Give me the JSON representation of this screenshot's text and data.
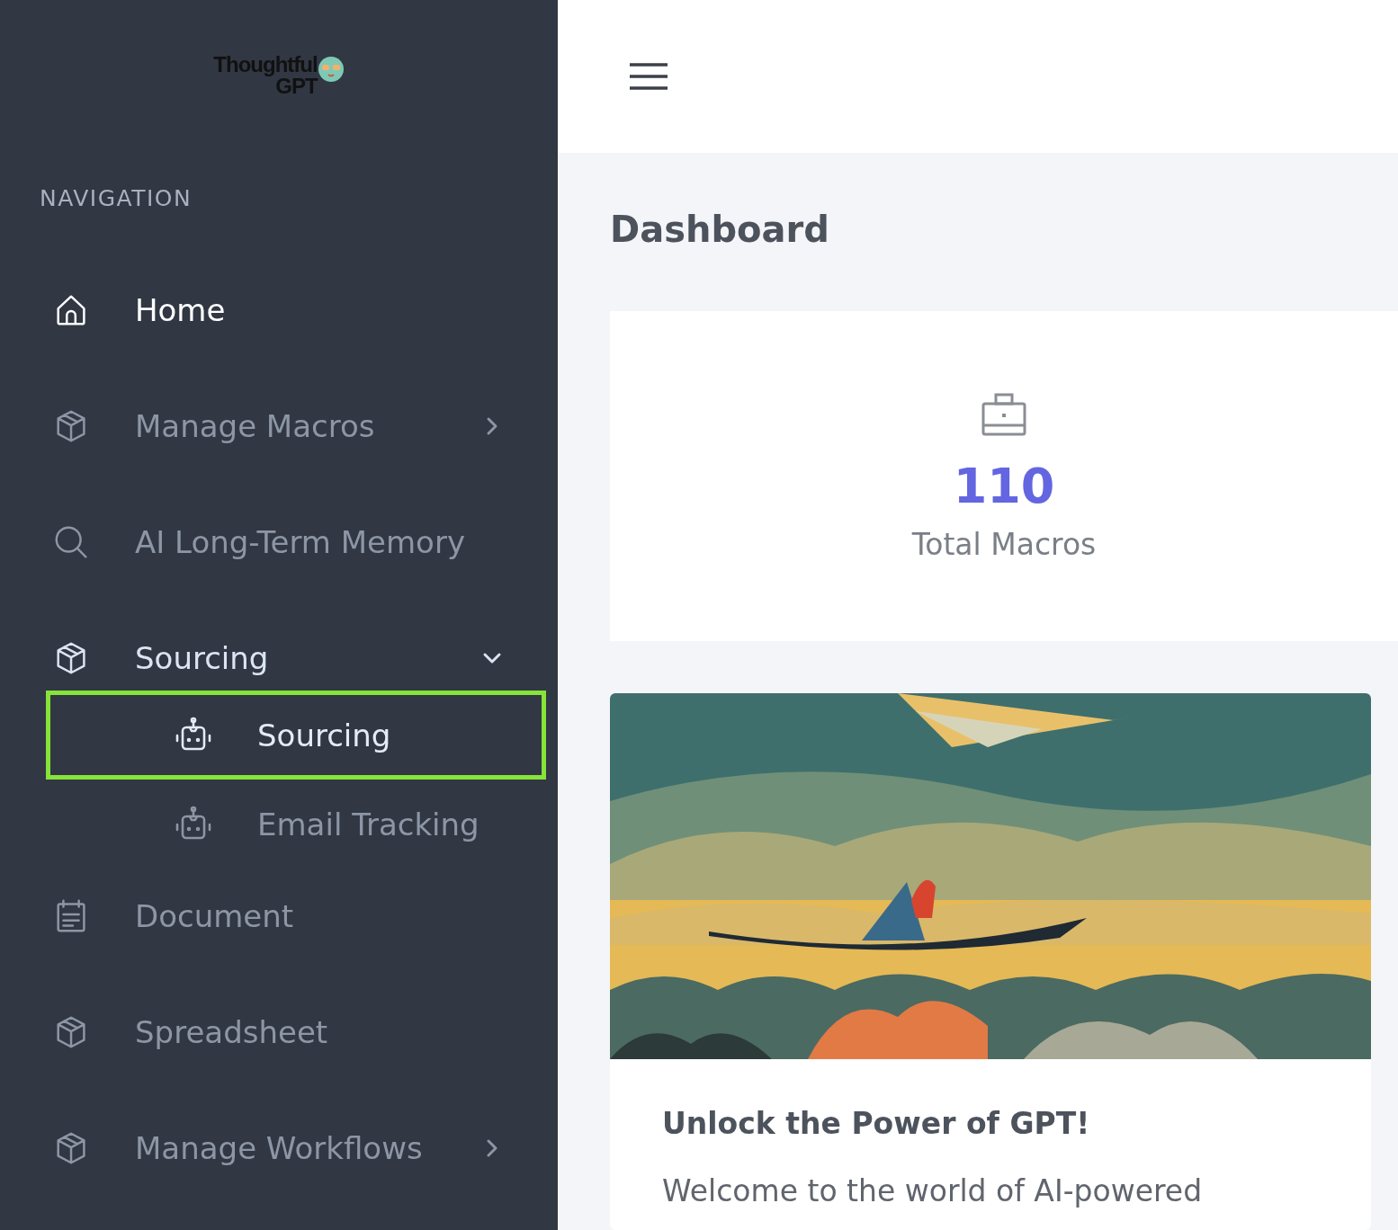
{
  "logo": {
    "line_1": "Thoughtful",
    "line_2": "GPT"
  },
  "sidebar": {
    "heading": "NAVIGATION",
    "items": [
      {
        "label": "Home",
        "selected": true
      },
      {
        "label": "Manage Macros",
        "selected": false,
        "expanded": false
      },
      {
        "label": "AI Long-Term Memory",
        "selected": false
      },
      {
        "label": "Sourcing",
        "selected": false,
        "expanded": true,
        "children": [
          {
            "label": "Sourcing",
            "selected": true
          },
          {
            "label": "Email Tracking",
            "selected": false
          }
        ]
      },
      {
        "label": "Document",
        "selected": false
      },
      {
        "label": "Spreadsheet",
        "selected": false
      },
      {
        "label": "Manage Workflows",
        "selected": false,
        "expanded": false
      }
    ]
  },
  "page_title": "Dashboard",
  "stat_card": {
    "value": "110",
    "label": "Total Macros"
  },
  "feature_card": {
    "title": "Unlock the Power of GPT!",
    "text": "Welcome to the world of AI-powered"
  }
}
